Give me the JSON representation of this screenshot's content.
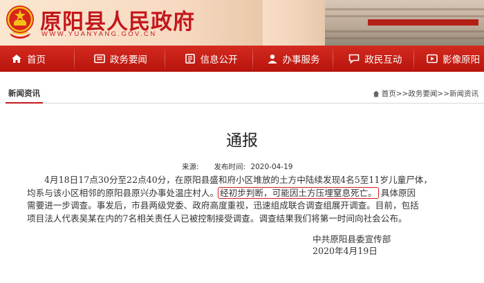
{
  "header": {
    "site_title": "原阳县人民政府",
    "site_url": "WWW.YUANYANG.GOV.CN"
  },
  "nav": {
    "items": [
      {
        "label": "首页",
        "icon": "home-icon"
      },
      {
        "label": "政务要闻",
        "icon": "news-icon"
      },
      {
        "label": "信息公开",
        "icon": "document-icon"
      },
      {
        "label": "办事服务",
        "icon": "person-icon"
      },
      {
        "label": "政民互动",
        "icon": "chat-icon"
      },
      {
        "label": "影像原阳",
        "icon": "film-icon"
      }
    ]
  },
  "section": {
    "tab_label": "新闻资讯",
    "breadcrumb": [
      "首页",
      ">>政务要闻",
      ">>新闻资讯"
    ]
  },
  "article": {
    "title": "通报",
    "source_label": "来源:",
    "date_label": "发布时间:",
    "date_value": "2020-04-19",
    "lines": {
      "l1": "4月18日17点30分至22点40分，在原阳县盛和府小区堆放的土方中陆续发现4名5至11岁儿童尸体，",
      "l2_pre": "均系与该小区相邻的原阳县原兴办事处温庄村人。",
      "l2_hl": "经初步判断，可能因土方压埋窒息死亡。",
      "l2_post": "具体原因",
      "l3": "需要进一步调查。事发后，市县两级党委、政府高度重视，迅速组成联合调查组展开调查。目前，包括",
      "l4": "项目法人代表吴某在内的7名相关责任人已被控制接受调查。调查结果我们将第一时间向社会公布。"
    },
    "signature_org": "中共原阳县委宣传部",
    "signature_date": "2020年4月19日"
  },
  "colors": {
    "brand_red": "#c4161c",
    "nav_red": "#c81e16",
    "highlight_box": "#d31b1b"
  }
}
